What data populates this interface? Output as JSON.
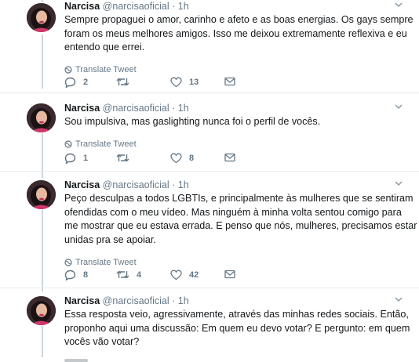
{
  "tweets": [
    {
      "name": "Narcisa",
      "handle": "@narcisaoficial",
      "separator": "·",
      "time": "1h",
      "lines": [
        "Sempre propaguei o amor, carinho e afeto e as boas energias. Os gays sempre",
        "foram os meus melhores amigos. Isso me deixou extremamente reflexiva e eu",
        "entendo que errei."
      ],
      "translate": "Translate Tweet",
      "replies": "2",
      "retweets": "",
      "likes": "13"
    },
    {
      "name": "Narcisa",
      "handle": "@narcisaoficial",
      "separator": "·",
      "time": "1h",
      "lines": [
        "Sou impulsiva, mas gaslighting nunca foi o perfil de vocês."
      ],
      "translate": "Translate Tweet",
      "replies": "1",
      "retweets": "",
      "likes": "8"
    },
    {
      "name": "Narcisa",
      "handle": "@narcisaoficial",
      "separator": "·",
      "time": "1h",
      "lines": [
        "Peço desculpas a todos LGBTIs, e principalmente às mulheres que se sentiram",
        "ofendidas com o meu vídeo. Mas ninguém à minha volta sentou comigo para",
        "me mostrar que eu estava errada. E penso que nós, mulheres, precisamos estar",
        "unidas pra se apoiar."
      ],
      "translate": "Translate Tweet",
      "replies": "8",
      "retweets": "4",
      "likes": "42"
    },
    {
      "name": "Narcisa",
      "handle": "@narcisaoficial",
      "separator": "·",
      "time": "1h",
      "lines": [
        "Essa resposta veio, agressivamente, através das minhas redes sociais. Então,",
        "proponho aqui uma discussão: Em quem eu devo votar? E pergunto: em quem",
        "vocês vão votar?"
      ],
      "translate": "",
      "replies": "",
      "retweets": "",
      "likes": ""
    }
  ],
  "icons": {
    "reply": "reply-icon",
    "retweet": "retweet-icon",
    "like": "like-icon",
    "message": "message-icon",
    "globe": "globe-icon",
    "caret": "chevron-down-icon"
  },
  "colors": {
    "text": "#14171a",
    "secondary": "#657786",
    "divider": "#e6ecf0",
    "thread_line": "#ccd6dd"
  }
}
